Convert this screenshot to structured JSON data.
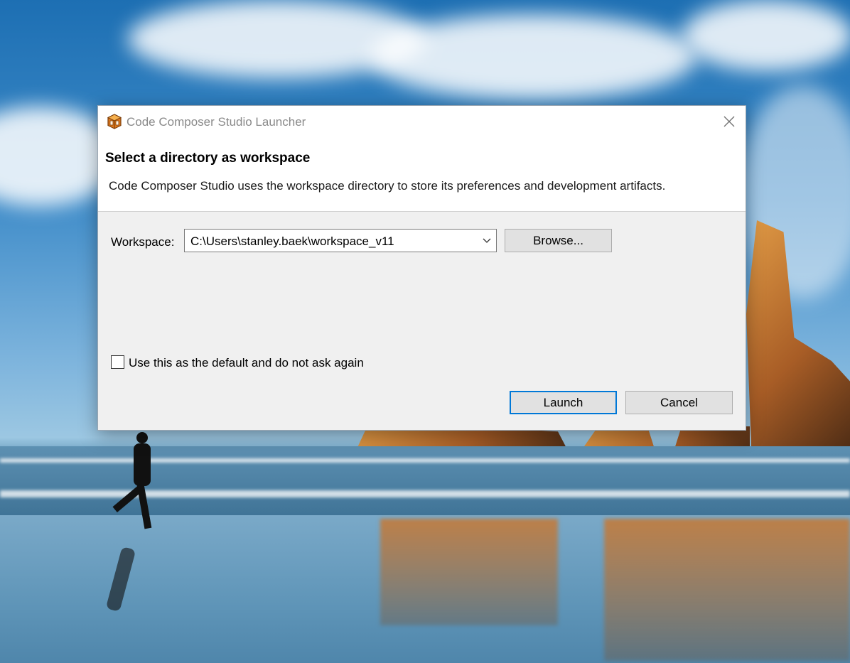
{
  "window": {
    "title": "Code Composer Studio Launcher",
    "app_icon": "ccs-cube-icon",
    "close_icon": "close-icon"
  },
  "header": {
    "title": "Select a directory as workspace",
    "description": "Code Composer Studio uses the workspace directory to store its preferences and development artifacts."
  },
  "workspace": {
    "label": "Workspace:",
    "value": "C:\\Users\\stanley.baek\\workspace_v11",
    "dropdown_icon": "chevron-down-icon",
    "browse_label": "Browse..."
  },
  "options": {
    "default_checkbox_label": "Use this as the default and do not ask again",
    "default_checked": false
  },
  "buttons": {
    "launch_label": "Launch",
    "cancel_label": "Cancel"
  },
  "colors": {
    "accent": "#0078d7",
    "dialog_bg": "#f0f0f0",
    "icon_orange": "#e07a1f"
  }
}
